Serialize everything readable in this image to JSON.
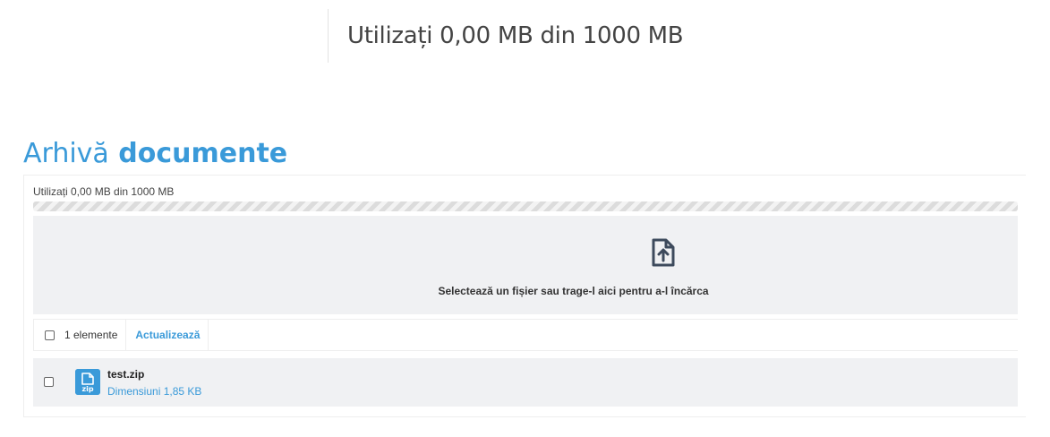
{
  "header": {
    "usage_text": "Utilizați 0,00 MB din 1000 MB"
  },
  "page": {
    "title_light": "Arhivă",
    "title_bold": "documente"
  },
  "storage": {
    "usage_text": "Utilizați 0,00 MB din 1000 MB",
    "used_mb": 0,
    "total_mb": 1000,
    "progress_fraction": 0
  },
  "dropzone": {
    "icon": "file-upload-icon",
    "text": "Selectează un fișier sau trage-l aici pentru a-l încărca"
  },
  "toolbar": {
    "count_text": "1 elemente",
    "refresh_label": "Actualizează",
    "select_all_checked": false
  },
  "files": [
    {
      "name": "test.zip",
      "size_text": "Dimensiuni 1,85 KB",
      "icon": "zip-file-icon",
      "checked": false
    }
  ],
  "colors": {
    "accent": "#3a9ad9",
    "panel_bg": "#f0f1f3"
  }
}
